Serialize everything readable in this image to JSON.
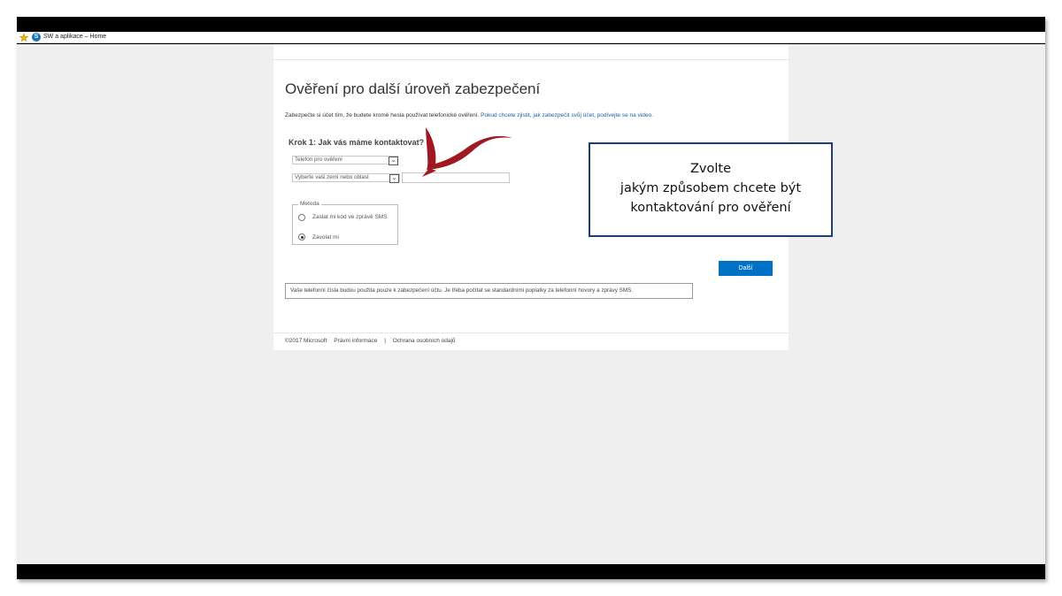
{
  "browser": {
    "tab_title": "SW a aplikace – Home",
    "tab_icon_letter": "S",
    "favorites_icon": "star-icon"
  },
  "page": {
    "title": "Ověření pro další úroveň zabezpečení",
    "intro_text": "Zabezpečte si účet tím, že budete kromě hesla používat telefonické ověření.",
    "intro_link": "Pokud chcete zjistit, jak zabezpečit svůj účet, podívejte se na video.",
    "step_heading": "Krok 1: Jak vás máme kontaktovat?",
    "contact_method_select": "Telefon pro ověření",
    "country_select": "Vyberte vaši zemi nebo oblast",
    "phone_input_value": "",
    "method": {
      "legend": "Metoda",
      "options": [
        {
          "label": "Zaslat mi kód ve zprávě SMS",
          "selected": false
        },
        {
          "label": "Zavolat mi",
          "selected": true
        }
      ]
    },
    "next_button": "Další",
    "notice": "Vaše telefonní čísla budou použita pouze k zabezpečení účtu. Je třeba počítat se standardními poplatky za telefonní hovory a zprávy SMS.",
    "footer": {
      "copyright": "©2017 Microsoft",
      "legal": "Právní informace",
      "separator": "|",
      "privacy": "Ochrana osobních údajů"
    }
  },
  "callout": {
    "line1": "Zvolte",
    "line2": "jakým způsobem chcete být",
    "line3": "kontaktování pro ověření"
  },
  "colors": {
    "accent": "#0072c6",
    "callout_border": "#1f3e77",
    "arrow": "#a01822"
  }
}
